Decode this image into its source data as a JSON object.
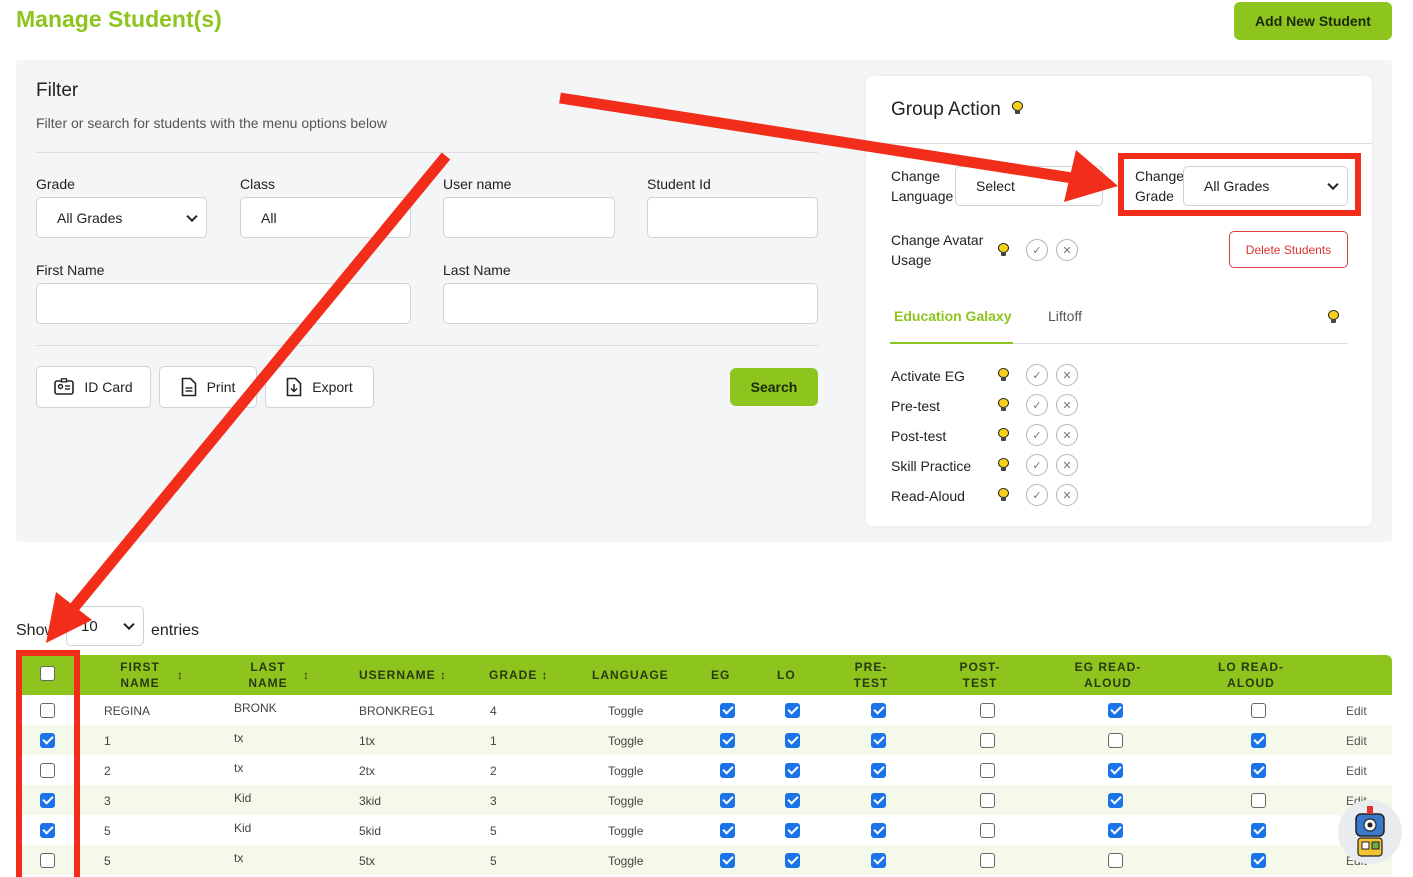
{
  "page_title": "Manage Student(s)",
  "add_button": "Add New Student",
  "filter": {
    "title": "Filter",
    "subtitle": "Filter or search for students with the menu options below",
    "grade_label": "Grade",
    "grade_value": "All Grades",
    "class_label": "Class",
    "class_value": "All",
    "username_label": "User name",
    "studentid_label": "Student Id",
    "firstname_label": "First Name",
    "lastname_label": "Last Name",
    "idcard_label": "ID Card",
    "print_label": "Print",
    "export_label": "Export",
    "search_label": "Search"
  },
  "group_action": {
    "title": "Group Action",
    "change_language_label": "Change Language",
    "change_language_l1": "Change",
    "change_language_l2": "Language",
    "language_value": "Select",
    "change_grade_l1": "Change",
    "change_grade_l2": "Grade",
    "grade_value": "All Grades",
    "avatar_l1": "Change Avatar",
    "avatar_l2": "Usage",
    "delete_label": "Delete Students",
    "tabs": [
      "Education Galaxy",
      "Liftoff"
    ],
    "items": [
      "Activate EG",
      "Pre-test",
      "Post-test",
      "Skill Practice",
      "Read-Aloud"
    ]
  },
  "table": {
    "show_label": "Show",
    "entries_value": "10",
    "entries_label": "entries",
    "headers": {
      "first_l1": "FIRST",
      "first_l2": "NAME",
      "last_l1": "LAST",
      "last_l2": "NAME",
      "username": "USERNAME ↕",
      "grade": "GRADE ↕",
      "language": "LANGUAGE",
      "eg": "EG",
      "lo": "LO",
      "pre_l1": "PRE-",
      "pre_l2": "TEST",
      "post_l1": "POST-",
      "post_l2": "TEST",
      "egra_l1": "EG READ-",
      "egra_l2": "ALOUD",
      "lora_l1": "LO READ-",
      "lora_l2": "ALOUD",
      "sort": "↕"
    },
    "rows": [
      {
        "first": "REGINA",
        "last": "BRONK",
        "username": "BRONKREG1",
        "grade": "4",
        "language": "Toggle",
        "edit": "Edit"
      },
      {
        "first": "1",
        "last": "tx",
        "username": "1tx",
        "grade": "1",
        "language": "Toggle",
        "edit": "Edit"
      },
      {
        "first": "2",
        "last": "tx",
        "username": "2tx",
        "grade": "2",
        "language": "Toggle",
        "edit": "Edit"
      },
      {
        "first": "3",
        "last": "Kid",
        "username": "3kid",
        "grade": "3",
        "language": "Toggle",
        "edit": "Edit"
      },
      {
        "first": "5",
        "last": "Kid",
        "username": "5kid",
        "grade": "5",
        "language": "Toggle",
        "edit": "Edit"
      },
      {
        "first": "5",
        "last": "tx",
        "username": "5tx",
        "grade": "5",
        "language": "Toggle",
        "edit": "Edit"
      }
    ],
    "checks": [
      [
        false,
        true,
        true,
        true,
        false,
        true,
        false
      ],
      [
        true,
        true,
        true,
        true,
        false,
        false,
        true
      ],
      [
        false,
        true,
        true,
        true,
        false,
        true,
        true
      ],
      [
        true,
        true,
        true,
        true,
        false,
        true,
        false
      ],
      [
        true,
        true,
        true,
        true,
        false,
        true,
        true
      ],
      [
        false,
        true,
        true,
        true,
        false,
        false,
        true
      ]
    ]
  },
  "colors": {
    "accent": "#8dc41e",
    "annotation": "#f22e1a",
    "checkbox": "#1a73e8"
  }
}
